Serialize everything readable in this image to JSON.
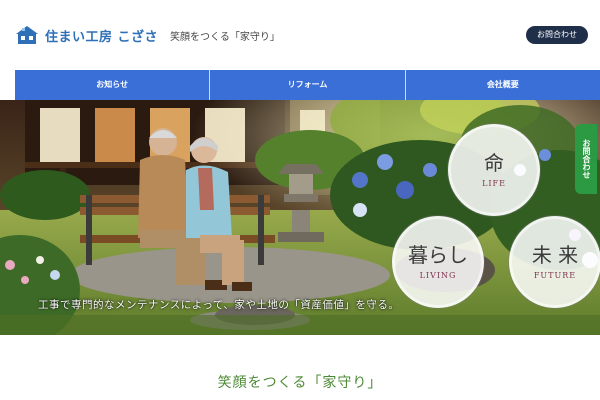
{
  "header": {
    "logo_name": "住まい工房 こざさ",
    "logo_tagline": "笑顔をつくる「家守り」",
    "contact_button": "お問合わせ"
  },
  "nav": {
    "items": [
      {
        "label": "お知らせ"
      },
      {
        "label": "リフォーム"
      },
      {
        "label": "会社概要"
      }
    ]
  },
  "hero": {
    "caption": "工事で専門的なメンテナンスによって、家や土地の「資産価値」を守る。",
    "circles": [
      {
        "jp": "命",
        "en": "LIFE"
      },
      {
        "jp": "暮らし",
        "en": "LIVING"
      },
      {
        "jp": "未 来",
        "en": "FUTURE"
      }
    ],
    "side_tab": "お問合わせ"
  },
  "main": {
    "tagline": "笑顔をつくる「家守り」"
  },
  "colors": {
    "brand_blue": "#2e6fb8",
    "nav_blue": "#3a6fd7",
    "button_navy": "#1f2f4a",
    "side_tab_green": "#2c9a42",
    "tagline_green": "#4b8a34"
  }
}
